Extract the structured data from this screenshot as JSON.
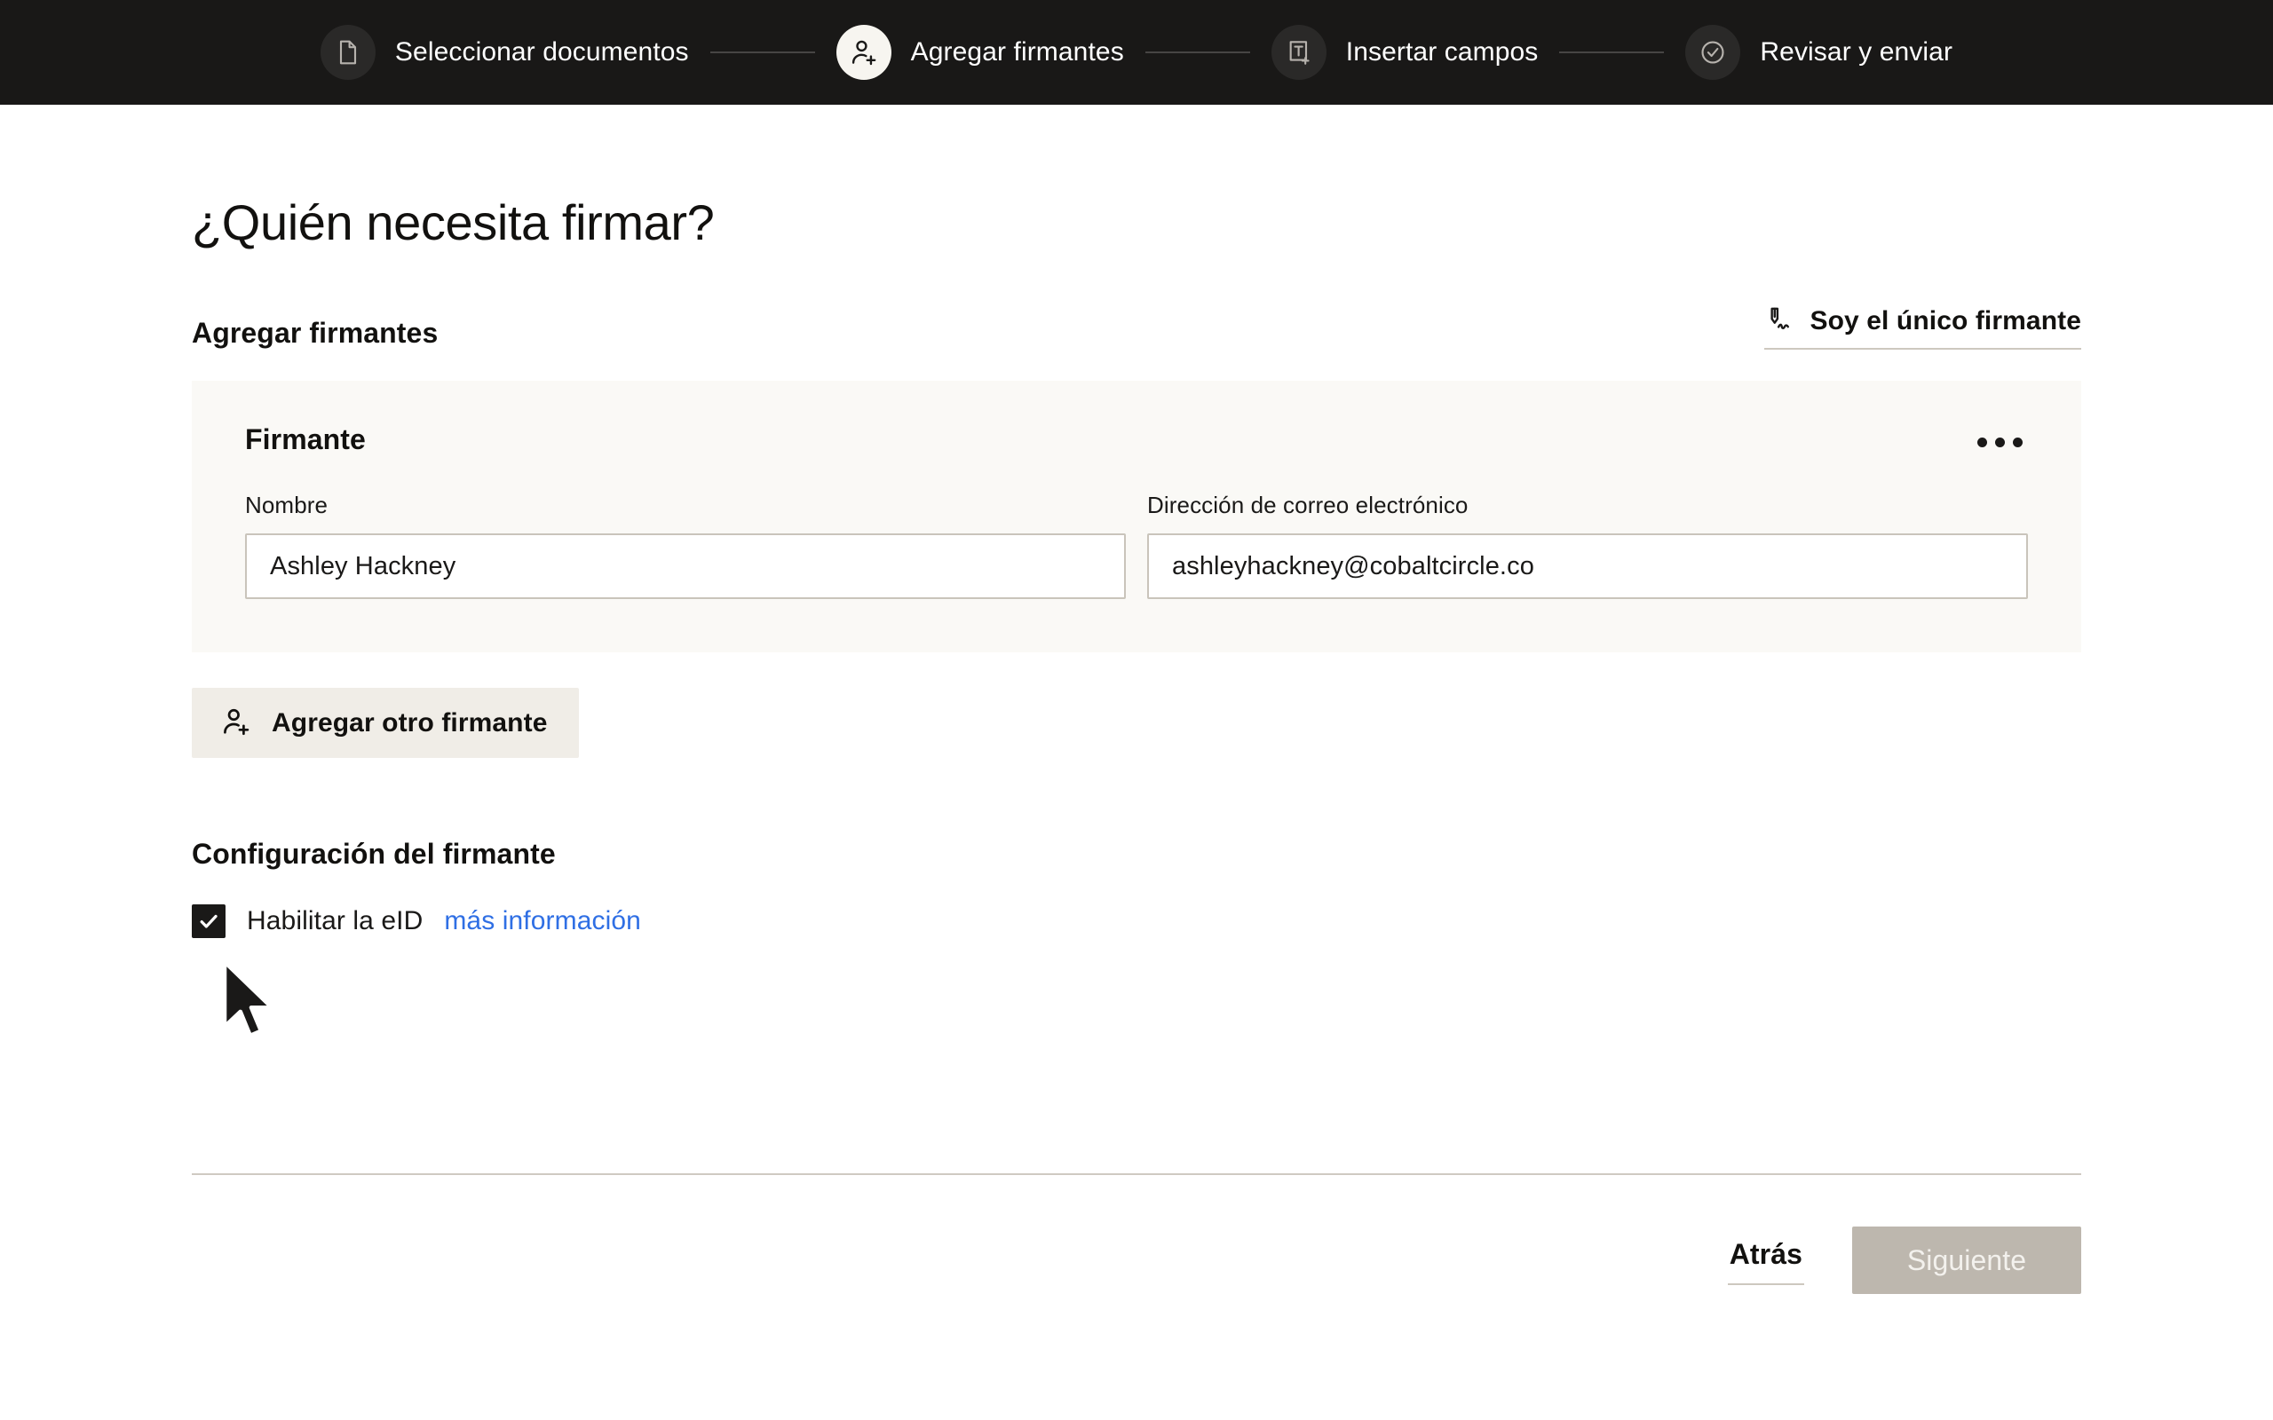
{
  "stepper": {
    "steps": [
      {
        "label": "Seleccionar documentos",
        "icon": "document-icon",
        "active": false
      },
      {
        "label": "Agregar firmantes",
        "icon": "person-add-icon",
        "active": true
      },
      {
        "label": "Insertar campos",
        "icon": "text-field-add-icon",
        "active": false
      },
      {
        "label": "Revisar y enviar",
        "icon": "check-circle-icon",
        "active": false
      }
    ]
  },
  "page": {
    "title": "¿Quién necesita firmar?"
  },
  "add_signers": {
    "heading": "Agregar firmantes",
    "sole_signer_label": "Soy el único firmante",
    "sole_signer_icon": "signature-pen-icon"
  },
  "signer_card": {
    "title": "Firmante",
    "menu_icon": "kebab-menu-icon",
    "name_label": "Nombre",
    "name_value": "Ashley Hackney",
    "name_placeholder": "Nombre",
    "email_label": "Dirección de correo electrónico",
    "email_value": "ashleyhackney@cobaltcircle.co",
    "email_placeholder": "Dirección de correo electrónico"
  },
  "add_another": {
    "label": "Agregar otro firmante",
    "icon": "person-add-icon"
  },
  "signer_settings": {
    "heading": "Configuración del firmante",
    "eid_label": "Habilitar la eID",
    "eid_checked": true,
    "more_info_label": "más información"
  },
  "footer": {
    "back_label": "Atrás",
    "next_label": "Siguiente",
    "next_disabled": true
  },
  "colors": {
    "topbar_bg": "#191817",
    "card_bg": "#faf9f6",
    "button_bg": "#f0ede7",
    "link_blue": "#2f6fe4",
    "disabled_button": "#bdb7ae",
    "text_primary": "#12110f",
    "border": "#c9c4bb"
  }
}
